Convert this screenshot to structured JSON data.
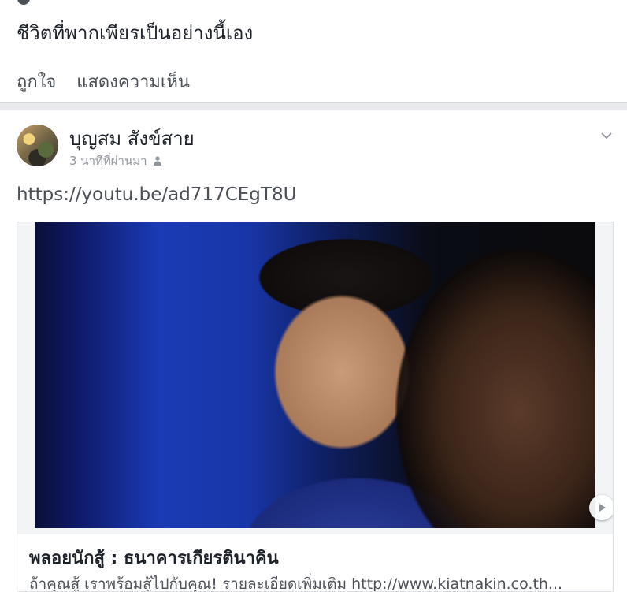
{
  "previous_post": {
    "text": "ชีวิตที่พากเพียรเป็นอย่างนี้เอง",
    "actions": [
      "ถูกใจ",
      "แสดงความเห็น"
    ]
  },
  "post": {
    "author": "บุญสม สังข์สาย",
    "timestamp": "3 นาทีที่ผ่านมา",
    "privacy_icon": "friends-icon",
    "menu_icon": "chevron-down-icon",
    "link": "https://youtu.be/ad717CEgT8U",
    "preview": {
      "title": "พลอยนักสู้ : ธนาคารเกียรตินาคิน",
      "description": "ถ้าคุณสู้ เราพร้อมสู้ไปกับคุณ! รายละเอียดเพิ่มเติม http://www.kiatnakin.co.th...",
      "play_icon": "play-icon"
    }
  },
  "colors": {
    "link": "#4b4f56",
    "separator": "#e9ebee",
    "meta": "#90949c"
  }
}
